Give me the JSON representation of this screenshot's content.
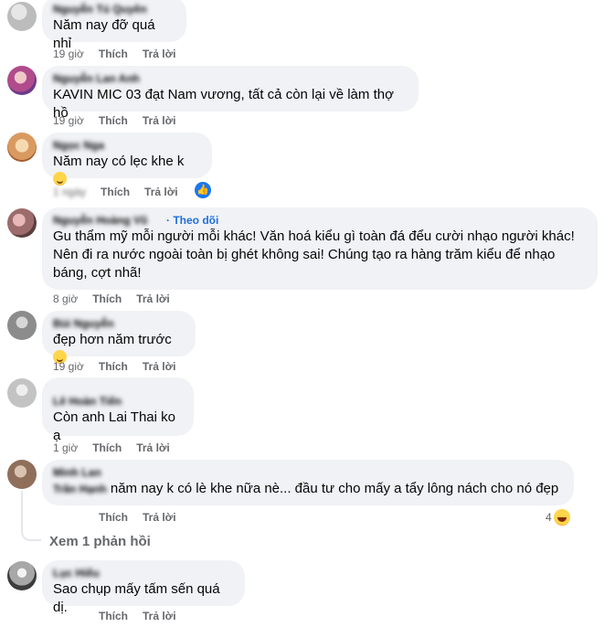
{
  "actions": {
    "like": "Thích",
    "reply": "Trả lời"
  },
  "comments": [
    {
      "name": "Nguyễn Tú Quyên",
      "text": "Năm nay đỡ quá nhỉ",
      "time": "19 giờ"
    },
    {
      "name": "Nguyễn Lan Anh",
      "text": "KAVIN MIC 03 đạt Nam vương, tất cả còn lại về làm thợ hồ",
      "time": "19 giờ"
    },
    {
      "name": "Ngọc Nga",
      "text": "Năm nay có lẹc khe k",
      "time": "1 ngày"
    },
    {
      "name": "Nguyễn Hoàng Vũ",
      "follow": "· Theo dõi",
      "text": "Gu thẩm mỹ mỗi người mỗi khác! Văn hoá kiểu gì toàn đá đểu cười nhạo người khác!\nNên đi ra nước ngoài toàn bị ghét không sai! Chúng tạo ra hàng trăm kiểu để nhạo\nbáng, cợt nhã!",
      "time": "8 giờ"
    },
    {
      "name": "Bùi Nguyễn",
      "text": "đẹp hơn năm trước",
      "time": "19 giờ"
    },
    {
      "name": "Lê Hoàn Tiến",
      "text": "Còn anh Lai Thai ko ạ",
      "time": "1 giờ"
    },
    {
      "name": "Minh Lan",
      "text": "năm nay k có lè khe nữa nè... đầu tư cho mấy a tẩy lông nách cho nó đẹp",
      "prefix": "Trần Hạnh",
      "time": "",
      "reaction_count": "4"
    },
    {
      "name": "Lục Hiếu",
      "text": "Sao chụp mấy tấm sến quá dị.",
      "time": ""
    }
  ],
  "view_replies": "Xem 1 phản hồi",
  "icons": {
    "like": "like-icon",
    "emoji": "grin-emoji-icon",
    "laugh": "laugh-emoji-icon"
  }
}
